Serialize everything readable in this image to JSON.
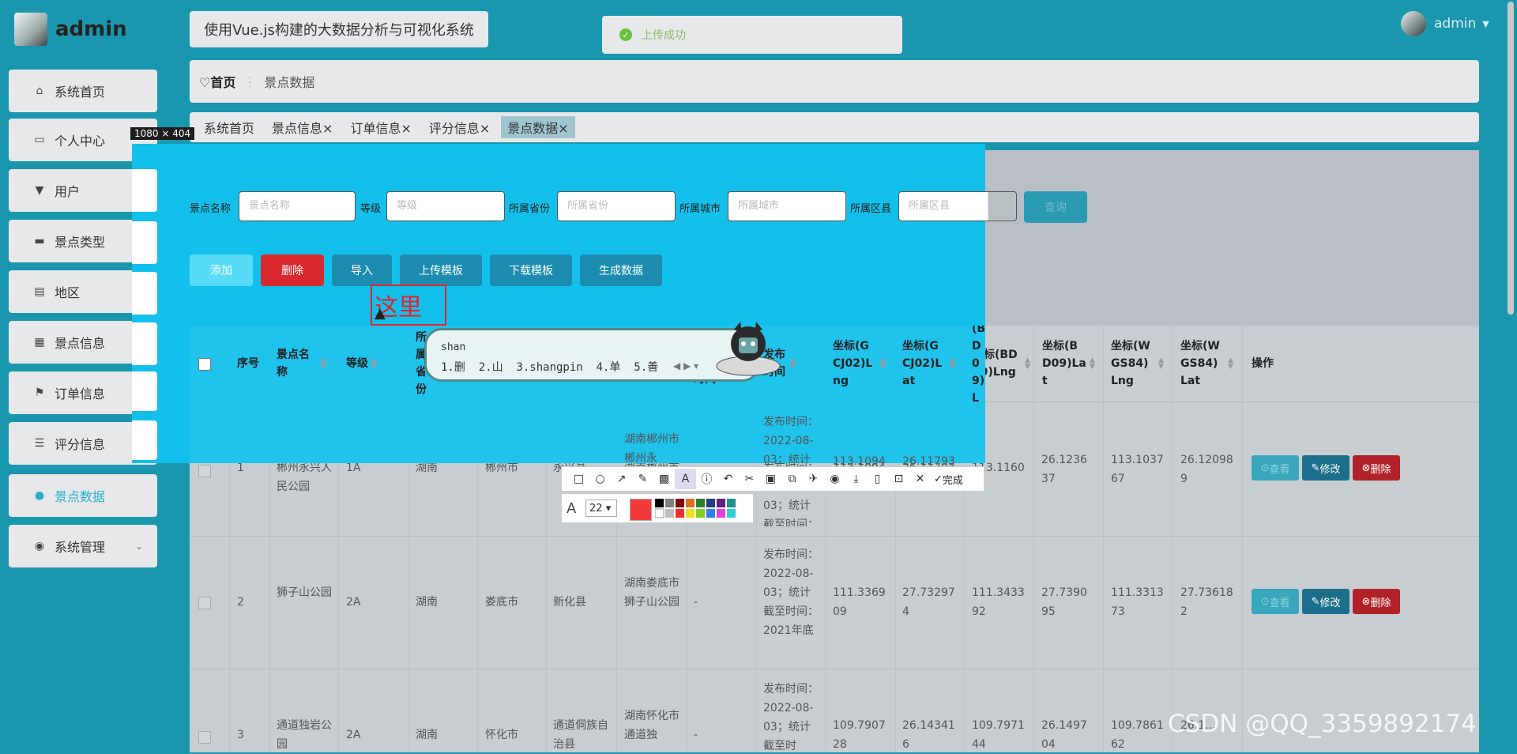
{
  "sidebar": {
    "logo_text": "admin",
    "items": [
      {
        "label": "系统首页",
        "icon": "home-icon"
      },
      {
        "label": "个人中心",
        "icon": "profile-card-icon"
      },
      {
        "label": "用户",
        "icon": "user-icon"
      },
      {
        "label": "景点类型",
        "icon": "category-icon"
      },
      {
        "label": "地区",
        "icon": "document-icon"
      },
      {
        "label": "景点信息",
        "icon": "grid-icon"
      },
      {
        "label": "订单信息",
        "icon": "flag-icon"
      },
      {
        "label": "评分信息",
        "icon": "list-icon"
      },
      {
        "label": "景点数据",
        "icon": "user-icon",
        "active": true
      },
      {
        "label": "系统管理",
        "icon": "globe-icon",
        "expandable": true
      }
    ]
  },
  "header": {
    "app_title": "使用Vue.js构建的大数据分析与可视化系统",
    "toast": "上传成功",
    "user_name": "admin"
  },
  "breadcrumb": {
    "home": "首页",
    "current": "景点数据"
  },
  "tabs": [
    "系统首页",
    "景点信息",
    "订单信息",
    "评分信息",
    "景点数据"
  ],
  "search": {
    "fields": [
      {
        "label": "景点名称",
        "placeholder": "景点名称"
      },
      {
        "label": "等级",
        "placeholder": "等级"
      },
      {
        "label": "所属省份",
        "placeholder": "所属省份"
      },
      {
        "label": "所属城市",
        "placeholder": "所属城市"
      },
      {
        "label": "所属区县",
        "placeholder": "所属区县"
      }
    ],
    "query_label": "查询"
  },
  "actions": {
    "add": "添加",
    "delete": "删除",
    "import": "导入",
    "upload_template": "上传模板",
    "download_template": "下载模板",
    "generate": "生成数据"
  },
  "table": {
    "headers": {
      "index": "序号",
      "name": "景点名称",
      "level": "等级",
      "province": "所属省份",
      "time": "时间",
      "pubtime": "发布时间",
      "gcj_lng": "坐标(GCJ02)Lng",
      "gcj_lat": "坐标(GCJ02)Lat",
      "bd_lng": "坐标(BD09)Lng",
      "bd_lat": "坐标(BD09)Lat",
      "wgs_lng": "坐标(WGS84)Lng",
      "wgs_lat": "坐标(WGS84)Lat",
      "ops": "操作"
    },
    "rows": [
      {
        "index": "1",
        "name": "郴州永兴人民公园",
        "level": "1A",
        "province": "湖南",
        "city": "郴州市",
        "county": "永兴县",
        "address": "湖南郴州市郴州永",
        "dash": "",
        "pubtime": "发布时间：2022-08-03；统计截至时间：2021年底",
        "gcj_lng": "113.1094",
        "gcj_lat": "26.11793",
        "bd_lng": "113.1160",
        "bd_lat": "26.123637",
        "wgs_lng": "113.103767",
        "wgs_lat": "26.120989"
      },
      {
        "index": "2",
        "name": "狮子山公园",
        "level": "2A",
        "province": "湖南",
        "city": "娄底市",
        "county": "新化县",
        "address": "湖南娄底市狮子山公园",
        "dash": "-",
        "pubtime": "发布时间：2022-08-03；统计截至时间：2021年底",
        "gcj_lng": "111.336909",
        "gcj_lat": "27.732974",
        "bd_lng": "111.343392",
        "bd_lat": "27.739095",
        "wgs_lng": "111.331373",
        "wgs_lat": "27.736182"
      },
      {
        "index": "3",
        "name": "通道独岩公园",
        "level": "2A",
        "province": "湖南",
        "city": "怀化市",
        "county": "通道侗族自治县",
        "address": "湖南怀化市通道独",
        "dash": "-",
        "pubtime": "发布时间：2022-08-03；统计截至时",
        "gcj_lng": "109.790728",
        "gcj_lat": "26.143416",
        "bd_lng": "109.797144",
        "bd_lat": "26.149704",
        "wgs_lng": "109.786162",
        "wgs_lat": "26.1..."
      }
    ],
    "row_buttons": {
      "view": "查看",
      "edit": "修改",
      "delete": "删除"
    }
  },
  "capture": {
    "size_label": "1080 × 404",
    "annotation": "这里",
    "ime_input": "shan",
    "ime_candidates": "1.删  2.山  3.shangpin  4.单  5.善",
    "font_size": "22",
    "done_label": "完成"
  },
  "watermark": "CSDN @QQ_3359892174",
  "colors": {
    "accent": "#13c0eb",
    "danger": "#d9292e",
    "primary": "#1b8cb0",
    "success": "#67c23a"
  }
}
